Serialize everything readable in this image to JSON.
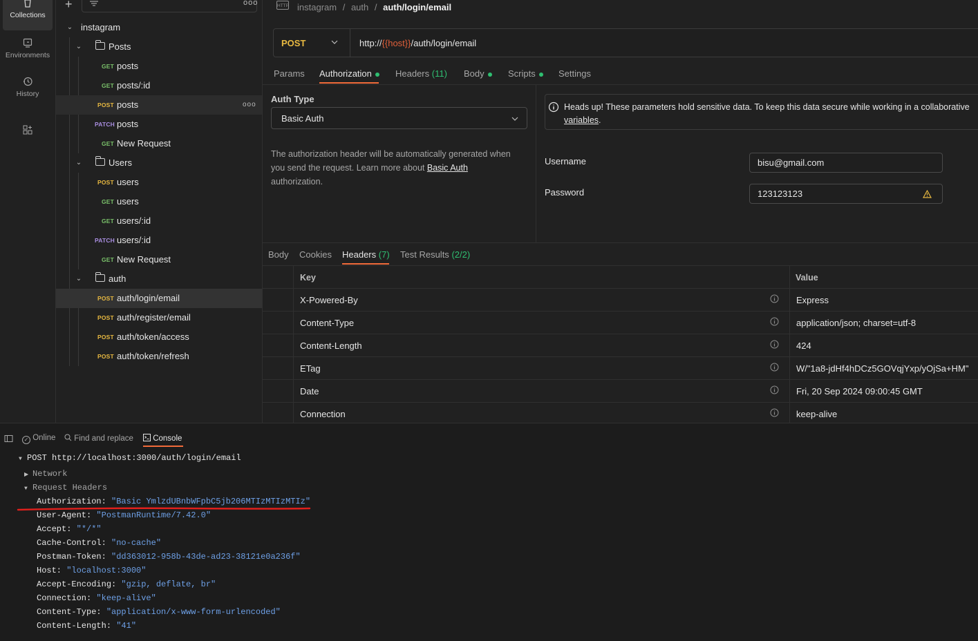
{
  "rail": {
    "items": [
      {
        "label": "Collections",
        "icon": "collections-icon",
        "active": true
      },
      {
        "label": "Environments",
        "icon": "environments-icon"
      },
      {
        "label": "History",
        "icon": "history-icon"
      }
    ]
  },
  "sidebar": {
    "collection": "instagram",
    "folders": [
      {
        "name": "Posts",
        "requests": [
          {
            "method": "GET",
            "name": "posts"
          },
          {
            "method": "GET",
            "name": "posts/:id"
          },
          {
            "method": "POST",
            "name": "posts"
          },
          {
            "method": "PATCH",
            "name": "posts"
          },
          {
            "method": "GET",
            "name": "New Request"
          }
        ]
      },
      {
        "name": "Users",
        "requests": [
          {
            "method": "POST",
            "name": "users"
          },
          {
            "method": "GET",
            "name": "users"
          },
          {
            "method": "GET",
            "name": "users/:id"
          },
          {
            "method": "PATCH",
            "name": "users/:id"
          },
          {
            "method": "GET",
            "name": "New Request"
          }
        ]
      },
      {
        "name": "auth",
        "requests": [
          {
            "method": "POST",
            "name": "auth/login/email"
          },
          {
            "method": "POST",
            "name": "auth/register/email"
          },
          {
            "method": "POST",
            "name": "auth/token/access"
          },
          {
            "method": "POST",
            "name": "auth/token/refresh"
          }
        ]
      }
    ]
  },
  "breadcrumb": {
    "icon_text": "HTTP",
    "parts": [
      "instagram",
      "auth"
    ],
    "current": "auth/login/email",
    "sep": "/"
  },
  "request": {
    "method": "POST",
    "url_prefix": "http://",
    "url_var": "{{host}}",
    "url_suffix": "/auth/login/email"
  },
  "request_tabs": [
    {
      "label": "Params"
    },
    {
      "label": "Authorization",
      "dot": true,
      "active": true
    },
    {
      "label": "Headers",
      "count": "(11)"
    },
    {
      "label": "Body",
      "dot": true
    },
    {
      "label": "Scripts",
      "dot": true
    },
    {
      "label": "Settings"
    }
  ],
  "auth": {
    "type_label": "Auth Type",
    "type_value": "Basic Auth",
    "desc_1": "The authorization header will be automatically generated when",
    "desc_2": "you send the request. Learn more about",
    "desc_link": "Basic Auth",
    "desc_3": "authorization.",
    "notice_1": "Heads up! These parameters hold sensitive data. To keep this data secure while working in a collaborative",
    "notice_link": "variables",
    "notice_end": ".",
    "username_label": "Username",
    "username_value": "bisu@gmail.com",
    "password_label": "Password",
    "password_value": "123123123"
  },
  "response_tabs": [
    {
      "label": "Body"
    },
    {
      "label": "Cookies"
    },
    {
      "label": "Headers",
      "count": "(7)",
      "active": true
    },
    {
      "label": "Test Results",
      "count": "(2/2)"
    }
  ],
  "response_headers": {
    "col_key": "Key",
    "col_value": "Value",
    "rows": [
      {
        "key": "X-Powered-By",
        "value": "Express"
      },
      {
        "key": "Content-Type",
        "value": "application/json; charset=utf-8"
      },
      {
        "key": "Content-Length",
        "value": "424"
      },
      {
        "key": "ETag",
        "value": "W/\"1a8-jdHf4hDCz5GOVqjYxp/yOjSa+HM\""
      },
      {
        "key": "Date",
        "value": "Fri, 20 Sep 2024 09:00:45 GMT"
      },
      {
        "key": "Connection",
        "value": "keep-alive"
      }
    ]
  },
  "statusbar": {
    "online": "Online",
    "find": "Find and replace",
    "console": "Console"
  },
  "console": {
    "request_line": "POST http://localhost:3000/auth/login/email",
    "network": "Network",
    "request_headers": "Request Headers",
    "headers": [
      {
        "key": "Authorization:",
        "value": "\"Basic YmlzdUBnbWFpbC5jb206MTIzMTIzMTIz\""
      },
      {
        "key": "User-Agent:",
        "value": "\"PostmanRuntime/7.42.0\""
      },
      {
        "key": "Accept:",
        "value": "\"*/*\""
      },
      {
        "key": "Cache-Control:",
        "value": "\"no-cache\""
      },
      {
        "key": "Postman-Token:",
        "value": "\"dd363012-958b-43de-ad23-38121e0a236f\""
      },
      {
        "key": "Host:",
        "value": "\"localhost:3000\""
      },
      {
        "key": "Accept-Encoding:",
        "value": "\"gzip, deflate, br\""
      },
      {
        "key": "Connection:",
        "value": "\"keep-alive\""
      },
      {
        "key": "Content-Type:",
        "value": "\"application/x-www-form-urlencoded\""
      },
      {
        "key": "Content-Length:",
        "value": "\"41\""
      }
    ]
  },
  "colors": {
    "accent": "#f26b3a",
    "get": "#7ac26a",
    "post": "#e8b941",
    "patch": "#a98ee0",
    "ok": "#2fbf71",
    "console_value": "#6ea0e6",
    "annotation": "#e0201c"
  }
}
